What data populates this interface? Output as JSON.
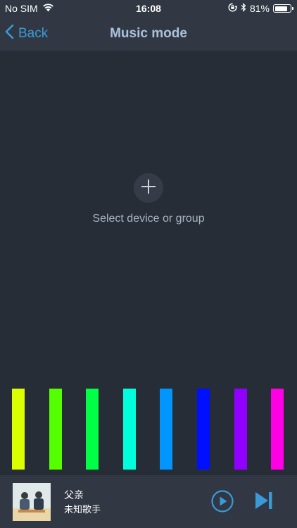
{
  "status_bar": {
    "carrier": "No SIM",
    "time": "16:08",
    "battery": "81%",
    "battery_level": 0.81,
    "icons": [
      "wifi-icon",
      "rotation-lock-icon",
      "bluetooth-icon",
      "battery-icon"
    ]
  },
  "nav": {
    "back_label": "Back",
    "title": "Music mode"
  },
  "empty_state": {
    "icon": "plus-icon",
    "label": "Select device or group"
  },
  "spectrum": {
    "colors": [
      "#dcff00",
      "#55ff00",
      "#00ff45",
      "#00ffdd",
      "#0095ff",
      "#0010ff",
      "#9100ff",
      "#ff00e4"
    ]
  },
  "player": {
    "title": "父亲",
    "artist": "未知歌手",
    "play_icon": "play-icon",
    "next_icon": "skip-next-icon"
  },
  "colors": {
    "background": "#262d36",
    "bar_background": "#313843",
    "accent": "#3a9ad9",
    "title": "#a9c1dc"
  }
}
